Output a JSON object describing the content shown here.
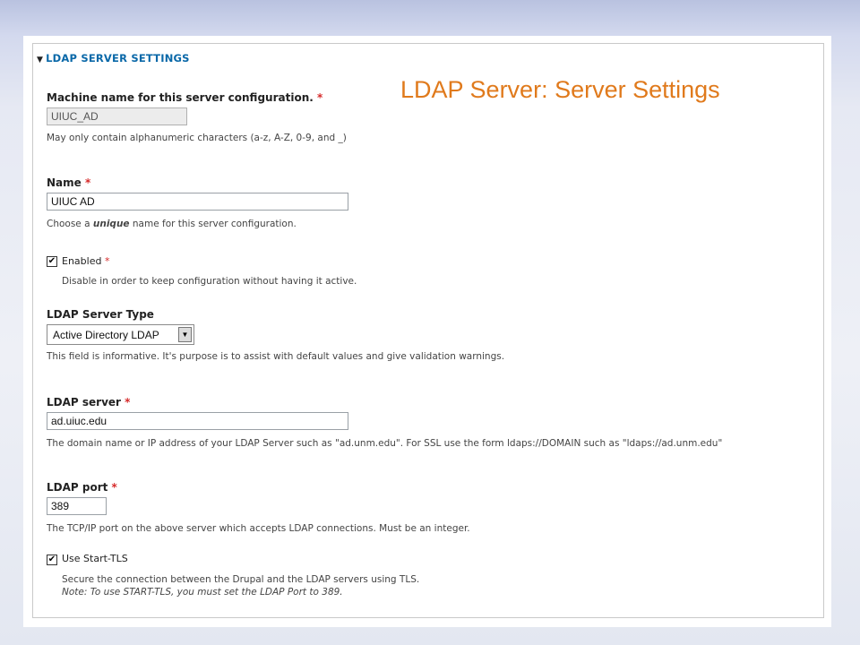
{
  "section": {
    "title": "LDAP SERVER SETTINGS",
    "icon": "triangle-down-icon"
  },
  "headline": "LDAP Server: Server Settings",
  "machine_name": {
    "label": "Machine name for this server configuration.",
    "required_mark": "*",
    "value": "UIUC_AD",
    "description": "May only contain alphanumeric characters (a-z, A-Z, 0-9, and _)"
  },
  "name": {
    "label": "Name",
    "required_mark": "*",
    "value": "UIUC AD",
    "desc_before": "Choose a ",
    "desc_emph": "unique",
    "desc_after": " name for this server configuration."
  },
  "enabled": {
    "label": "Enabled",
    "required_mark": "*",
    "checked_glyph": "✔",
    "description": "Disable in order to keep configuration without having it active."
  },
  "server_type": {
    "label": "LDAP Server Type",
    "value": "Active Directory LDAP",
    "description": "This field is informative. It's purpose is to assist with default values and give validation warnings."
  },
  "server": {
    "label": "LDAP server",
    "required_mark": "*",
    "value": "ad.uiuc.edu",
    "description": "The domain name or IP address of your LDAP Server such as \"ad.unm.edu\". For SSL use the form ldaps://DOMAIN such as \"ldaps://ad.unm.edu\""
  },
  "port": {
    "label": "LDAP port",
    "required_mark": "*",
    "value": "389",
    "description": "The TCP/IP port on the above server which accepts LDAP connections. Must be an integer."
  },
  "start_tls": {
    "label": "Use Start-TLS",
    "checked_glyph": "✔",
    "description": "Secure the connection between the Drupal and the LDAP servers using TLS.",
    "note": "Note: To use START-TLS, you must set the LDAP Port to 389."
  }
}
